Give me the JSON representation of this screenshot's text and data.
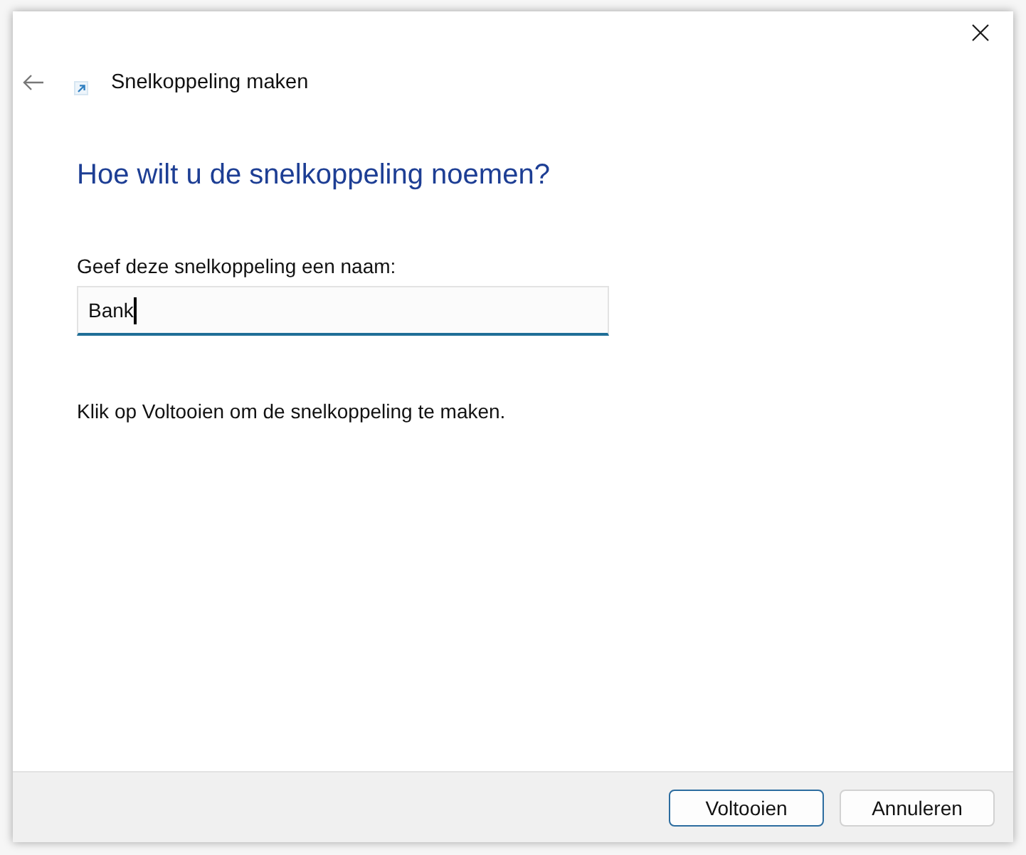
{
  "window": {
    "title": "Snelkoppeling maken"
  },
  "heading": "Hoe wilt u de snelkoppeling noemen?",
  "name_field": {
    "label": "Geef deze snelkoppeling een naam:",
    "value": "Bank",
    "focused": true
  },
  "instruction": "Klik op Voltooien om de snelkoppeling te maken.",
  "buttons": [
    {
      "label": "Voltooien",
      "default": true
    },
    {
      "label": "Annuleren",
      "default": false
    }
  ]
}
